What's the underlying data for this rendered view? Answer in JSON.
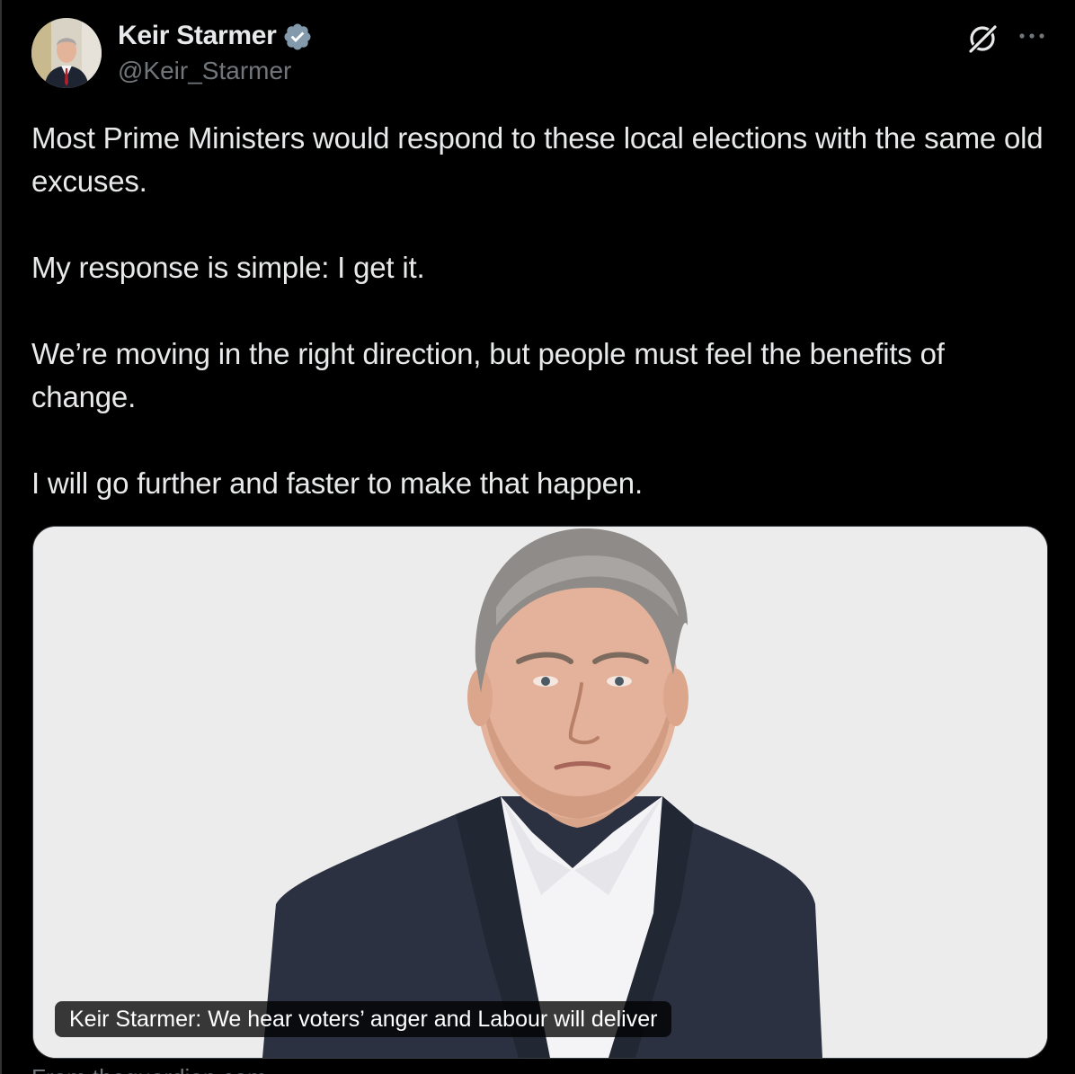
{
  "author": {
    "display_name": "Keir Starmer",
    "handle": "@Keir_Starmer",
    "verified": true,
    "avatar_icon": "avatar-photo"
  },
  "header_actions": {
    "grok_icon": "grok-icon",
    "more_icon": "more-icon"
  },
  "tweet": {
    "paragraphs": [
      "Most Prime Ministers would respond to these local elections with the same old excuses.",
      "My response is simple: I get it.",
      "We’re moving in the right direction, but people must feel the benefits of change.",
      "I will go further and faster to make that happen."
    ]
  },
  "card": {
    "caption": "Keir Starmer: We hear voters’ anger and Labour will deliver",
    "source_domain": "From theguardian.com"
  },
  "colors": {
    "background": "#000000",
    "text": "#e7e9ea",
    "secondary_text": "#71767b",
    "verified_badge": "#829aab",
    "card_background": "#ececec"
  }
}
